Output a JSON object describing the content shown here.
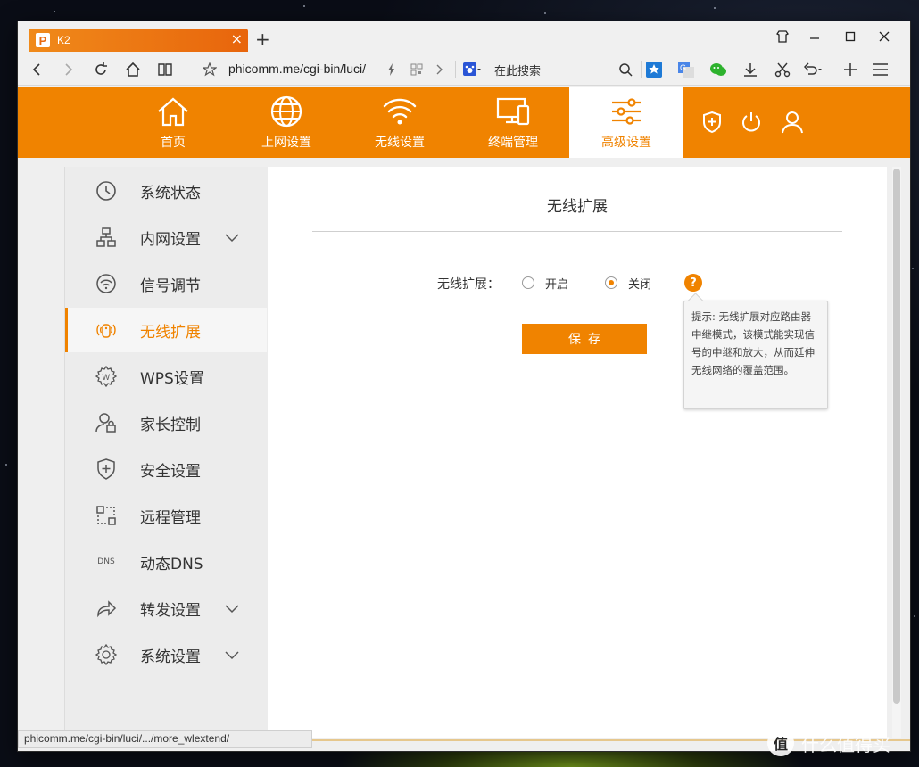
{
  "browser": {
    "tab_title": "K2",
    "tab_close": "×",
    "new_tab": "+",
    "url": "phicomm.me/cgi-bin/luci/",
    "search_placeholder": "在此搜索",
    "status_url": "phicomm.me/cgi-bin/luci/.../more_wlextend/",
    "accent": "#f08300"
  },
  "nav": {
    "items": [
      {
        "label": "首页",
        "icon": "home-icon"
      },
      {
        "label": "上网设置",
        "icon": "globe-icon"
      },
      {
        "label": "无线设置",
        "icon": "wifi-icon"
      },
      {
        "label": "终端管理",
        "icon": "devices-icon"
      },
      {
        "label": "高级设置",
        "icon": "sliders-icon",
        "active": true
      }
    ],
    "right_icons": [
      "shield-plus-icon",
      "power-icon",
      "user-icon"
    ]
  },
  "sidebar": {
    "items": [
      {
        "label": "系统状态",
        "icon": "clock-icon"
      },
      {
        "label": "内网设置",
        "icon": "network-icon",
        "expandable": true
      },
      {
        "label": "信号调节",
        "icon": "signal-icon"
      },
      {
        "label": "无线扩展",
        "icon": "wireless-extend-icon",
        "active": true
      },
      {
        "label": "WPS设置",
        "icon": "wps-gear-icon"
      },
      {
        "label": "家长控制",
        "icon": "parent-lock-icon"
      },
      {
        "label": "安全设置",
        "icon": "shield-icon"
      },
      {
        "label": "远程管理",
        "icon": "remote-icon"
      },
      {
        "label": "动态DNS",
        "icon": "dns-icon"
      },
      {
        "label": "转发设置",
        "icon": "forward-icon",
        "expandable": true
      },
      {
        "label": "系统设置",
        "icon": "settings-gear-icon",
        "expandable": true
      }
    ],
    "dns_badge": "DNS",
    "wps_badge": "W"
  },
  "main": {
    "title": "无线扩展",
    "field_label": "无线扩展：",
    "option_on": "开启",
    "option_off": "关闭",
    "selected": "关闭",
    "help": "?",
    "tooltip": "提示: 无线扩展对应路由器中继模式，该模式能实现信号的中继和放大，从而延伸无线网络的覆盖范围。",
    "save_label": "保存"
  },
  "watermark": {
    "logo": "值",
    "text": "什么值得买"
  }
}
